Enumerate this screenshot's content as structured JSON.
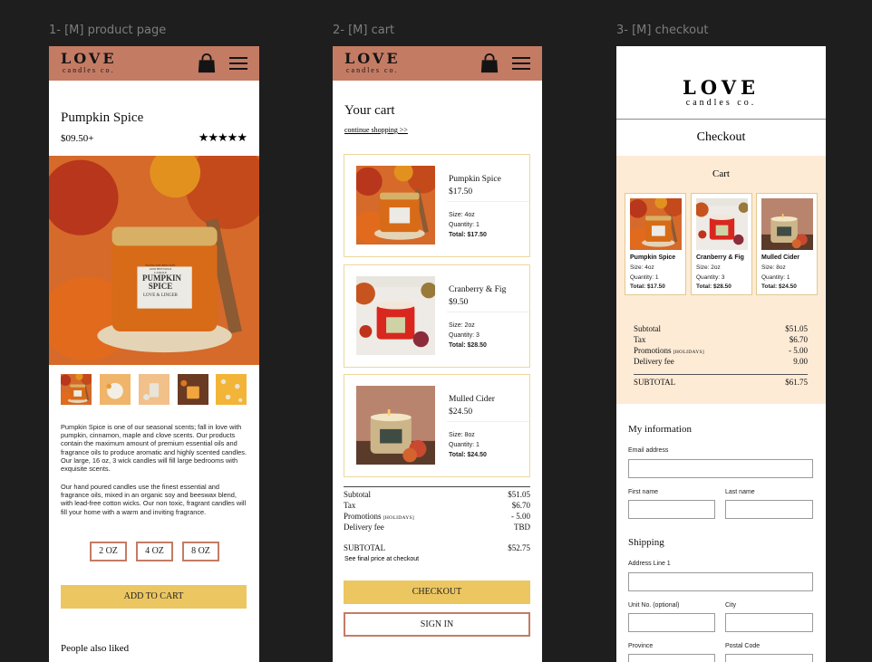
{
  "frames": [
    {
      "label": "1- [M] product page"
    },
    {
      "label": "2- [M] cart"
    },
    {
      "label": "3- [M] checkout"
    }
  ],
  "brand": {
    "logo_main": "LOVE",
    "logo_sub": "candles co."
  },
  "icons": {
    "bag": "shopping-bag-icon",
    "menu": "hamburger-menu-icon"
  },
  "colors": {
    "header": "#c47b64",
    "accent_yellow": "#ecc660",
    "cart_bg": "#fdebd6",
    "card_border": "#ecd79c"
  },
  "product": {
    "title": "Pumpkin Spice",
    "price": "$09.50+",
    "rating": "★★★★★",
    "jar_label": {
      "top": "HAND-POURED SOY AND BEESWAX CANDLE",
      "line1": "PUMPKIN",
      "line2": "SPICE",
      "brand": "LOVE & LINGER"
    },
    "description_1": "Pumpkin Spice is one of our seasonal scents; fall in love with pumpkin, cinnamon, maple and clove scents. Our products contain the maximum amount of premium essential oils and fragrance oils to produce aromatic and highly scented candles. Our large, 16 oz, 3 wick candles will fill large bedrooms with exquisite scents.",
    "description_2": "Our hand poured candles use the finest essential and fragrance oils, mixed in an organic soy and beeswax blend, with lead-free cotton wicks. Our non toxic, fragrant candles will fill your home with a warm and inviting fragrance.",
    "sizes": [
      "2 OZ",
      "4 OZ",
      "8 OZ"
    ],
    "add_to_cart": "ADD TO CART",
    "also_liked": "People also liked"
  },
  "cart": {
    "title": "Your cart",
    "continue": "continue shopping >>",
    "items": [
      {
        "name": "Pumpkin Spice",
        "price": "$17.50",
        "size": "Size: 4oz",
        "qty": "Quantity: 1",
        "total": "Total: $17.50"
      },
      {
        "name": "Cranberry & Fig",
        "price": "$9.50",
        "size": "Size: 2oz",
        "qty": "Quantity: 3",
        "total": "Total: $28.50"
      },
      {
        "name": "Mulled Cider",
        "price": "$24.50",
        "size": "Size: 8oz",
        "qty": "Quantity: 1",
        "total": "Total: $24.50"
      }
    ],
    "summary": {
      "subtotal_label": "Subtotal",
      "subtotal": "$51.05",
      "tax_label": "Tax",
      "tax": "$6.70",
      "promo_label": "Promotions",
      "promo_code": "[HOLIDAYS]",
      "promo": "- 5.00",
      "delivery_label": "Delivery fee",
      "delivery": "TBD",
      "total_label": "SUBTOTAL",
      "total": "$52.75",
      "note": "See final price at checkout"
    },
    "checkout_btn": "CHECKOUT",
    "signin_btn": "SIGN IN"
  },
  "checkout": {
    "title": "Checkout",
    "cart_title": "Cart",
    "items": [
      {
        "name": "Pumpkin Spice",
        "size": "Size: 4oz",
        "qty": "Quantity: 1",
        "total": "Total: $17.50"
      },
      {
        "name": "Cranberry & Fig",
        "size": "Size: 2oz",
        "qty": "Quantity: 3",
        "total": "Total: $28.50"
      },
      {
        "name": "Mulled Cider",
        "size": "Size: 8oz",
        "qty": "Quantity: 1",
        "total": "Total: $24.50"
      }
    ],
    "summary": {
      "subtotal_label": "Subtotal",
      "subtotal": "$51.05",
      "tax_label": "Tax",
      "tax": "$6.70",
      "promo_label": "Promotions",
      "promo_code": "[HOLIDAYS]",
      "promo": "- 5.00",
      "delivery_label": "Delivery fee",
      "delivery": "9.00",
      "total_label": "SUBTOTAL",
      "total": "$61.75"
    },
    "info_title": "My information",
    "email_label": "Email address",
    "first_label": "First name",
    "last_label": "Last name",
    "shipping_title": "Shipping",
    "address_label": "Address Line 1",
    "unit_label": "Unit No. (optional)",
    "city_label": "City",
    "province_label": "Province",
    "postal_label": "Postal Code"
  }
}
